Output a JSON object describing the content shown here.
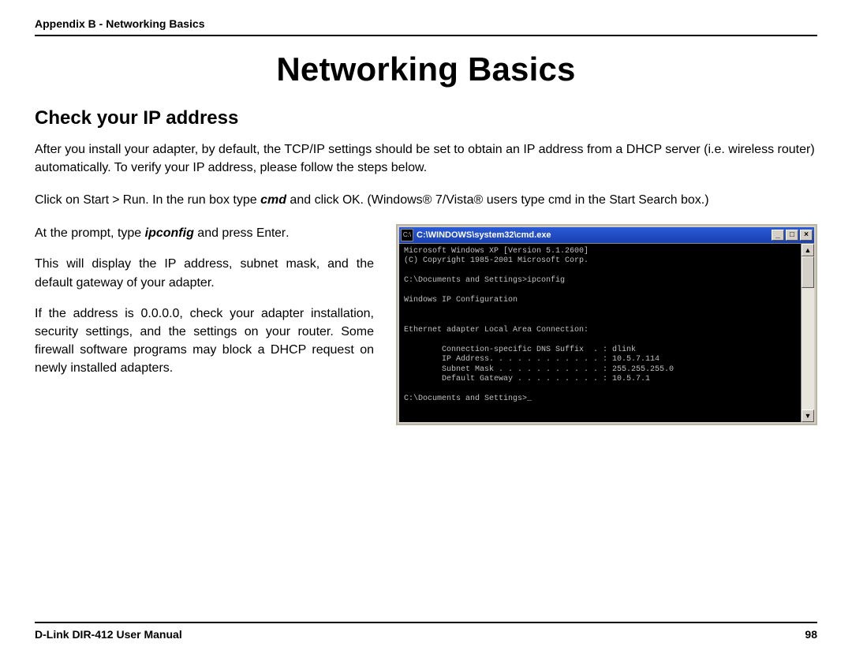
{
  "header": "Appendix B - Networking Basics",
  "title": "Networking Basics",
  "subtitle": "Check your IP address",
  "intro": "After you install your adapter, by default, the TCP/IP settings should be set to obtain an IP address from a DHCP server (i.e. wireless router) automatically. To verify your IP address, please follow the steps below.",
  "step1": {
    "t1": "Click on ",
    "startrun": "Start > Run",
    "t2": ". In the run box type ",
    "cmd": "cmd",
    "t3": " and click ",
    "ok": "OK",
    "t4": ". (Windows® 7/Vista® users type ",
    "cmd2": "cmd",
    "t5": " in the ",
    "startsearch": "Start Search",
    "t6": " box.)"
  },
  "left": {
    "p1a": "At the prompt, type ",
    "p1b": "ipconfig",
    "p1c": " and press ",
    "p1d": "Enter",
    "p1e": ".",
    "p2": "This will display the IP address, subnet mask, and the default gateway of your adapter.",
    "p3": "If the address is 0.0.0.0, check your adapter installation, security settings, and the settings on your router. Some firewall software programs may block a DHCP request on newly installed adapters."
  },
  "cmdwin": {
    "icon": "C:\\",
    "title": "C:\\WINDOWS\\system32\\cmd.exe",
    "btn_min": "_",
    "btn_max": "□",
    "btn_close": "×",
    "sb_up": "▲",
    "sb_down": "▼",
    "console": "Microsoft Windows XP [Version 5.1.2600]\n(C) Copyright 1985-2001 Microsoft Corp.\n\nC:\\Documents and Settings>ipconfig\n\nWindows IP Configuration\n\n\nEthernet adapter Local Area Connection:\n\n        Connection-specific DNS Suffix  . : dlink\n        IP Address. . . . . . . . . . . . : 10.5.7.114\n        Subnet Mask . . . . . . . . . . . : 255.255.255.0\n        Default Gateway . . . . . . . . . : 10.5.7.1\n\nC:\\Documents and Settings>_"
  },
  "footer": {
    "left": "D-Link DIR-412 User Manual",
    "right": "98"
  }
}
